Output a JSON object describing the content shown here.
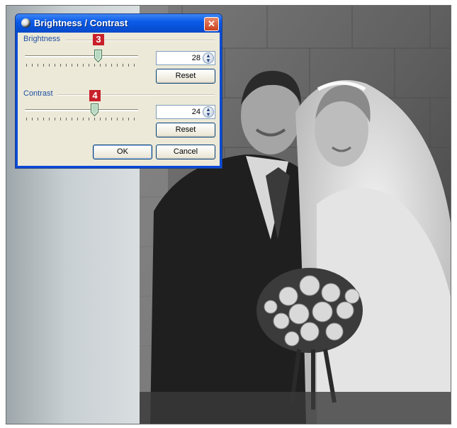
{
  "dialog": {
    "title": "Brightness / Contrast",
    "close_symbol": "✕",
    "brightness": {
      "label": "Brightness",
      "value": "28",
      "slider_value": 28,
      "reset_label": "Reset",
      "callout": "3"
    },
    "contrast": {
      "label": "Contrast",
      "value": "24",
      "slider_value": 24,
      "reset_label": "Reset",
      "callout": "4"
    },
    "ok_label": "OK",
    "cancel_label": "Cancel",
    "icons": {
      "title": "brightness-contrast-icon",
      "close": "close-icon",
      "spin": "spin-arrows-icon"
    }
  },
  "photo": {
    "subject": "wedding-photo"
  },
  "colors": {
    "titlebar": "#0b5be8",
    "dialog_body": "#ece9d8",
    "callout": "#c8202a"
  }
}
